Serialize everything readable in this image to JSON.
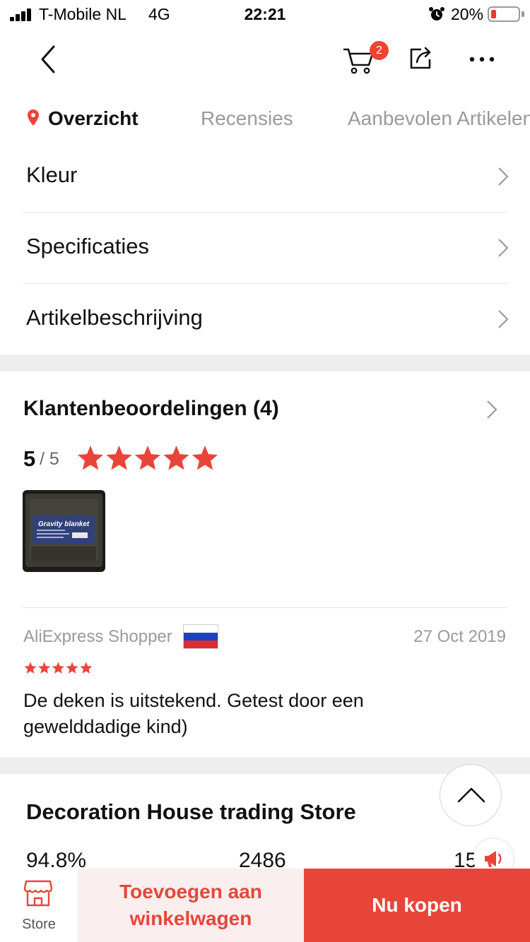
{
  "status_bar": {
    "carrier": "T-Mobile NL",
    "network": "4G",
    "time": "22:21",
    "battery_percent": "20%",
    "battery_level": 0.2
  },
  "nav": {
    "back_icon": "chevron-left-icon",
    "cart_icon": "cart-icon",
    "cart_count": "2",
    "share_icon": "share-icon",
    "more_icon": "more-icon"
  },
  "tabs": [
    {
      "label": "Overzicht",
      "active": true
    },
    {
      "label": "Recensies",
      "active": false
    },
    {
      "label": "Aanbevolen Artikelen",
      "active": false
    }
  ],
  "menu": [
    {
      "label": "Kleur"
    },
    {
      "label": "Specificaties"
    },
    {
      "label": "Artikelbeschrijving"
    }
  ],
  "reviews": {
    "title": "Klantenbeoordelingen (4)",
    "score": "5",
    "score_total": "/ 5",
    "rating": 5,
    "review": {
      "author": "AliExpress Shopper",
      "country_flag": "russia-flag",
      "date": "27 Oct 2019",
      "rating": 5,
      "text": "De deken is uitstekend. Getest door een gewelddadige kind)"
    },
    "photo_caption": "Gravity blanket"
  },
  "store": {
    "name": "Decoration House trading Store",
    "stats": [
      "94.8%",
      "2486",
      "15"
    ]
  },
  "bottom_bar": {
    "store_label": "Store",
    "add_to_cart_label": "Toevoegen aan winkelwagen",
    "buy_now_label": "Nu kopen"
  },
  "colors": {
    "accent": "#e8453a",
    "star": "#e8453a",
    "badge": "#ee4433"
  }
}
